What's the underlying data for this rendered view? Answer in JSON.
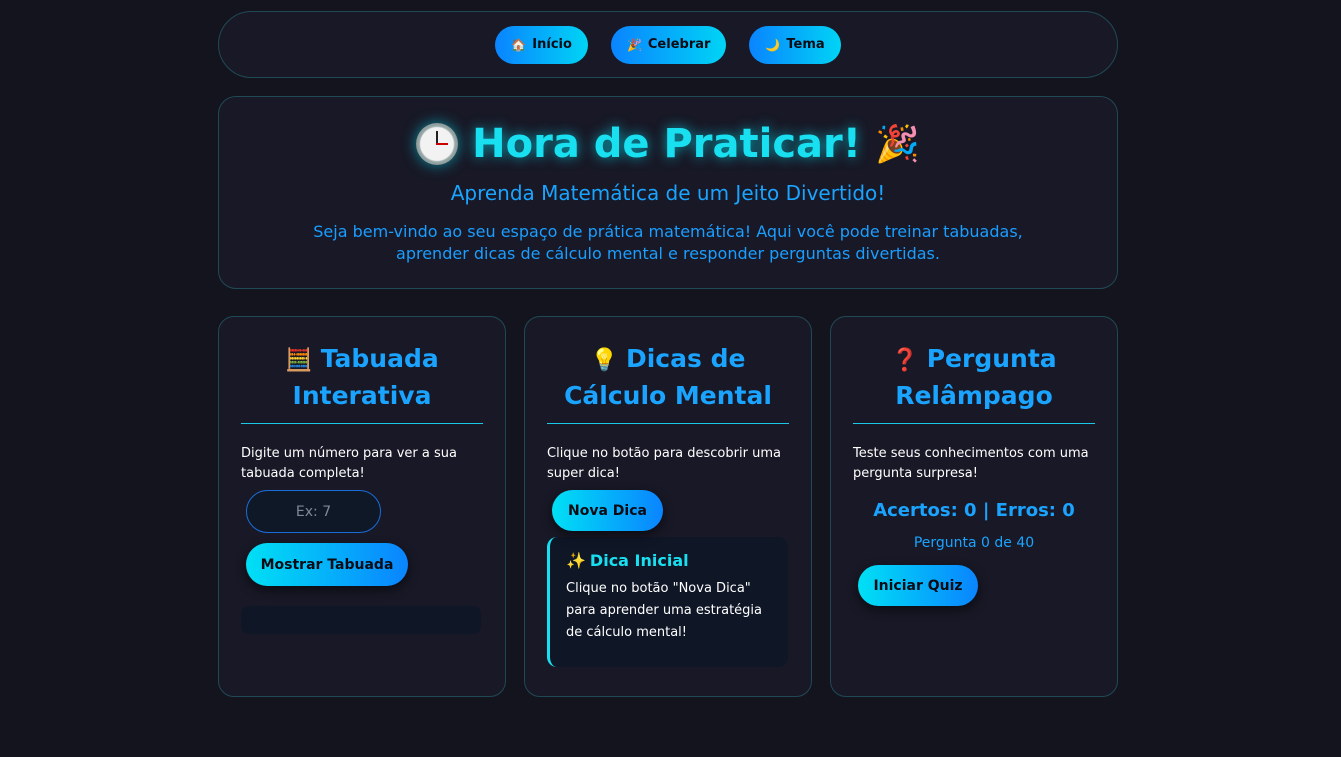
{
  "nav": {
    "items": [
      {
        "icon": "🏠",
        "label": "Início"
      },
      {
        "icon": "🎉",
        "label": "Celebrar"
      },
      {
        "icon": "🌙",
        "label": "Tema"
      }
    ]
  },
  "hero": {
    "title": "Hora de Praticar!",
    "party_icon": "🎉",
    "subtitle": "Aprenda Matemática de um Jeito Divertido!",
    "desc_line1": "Seja bem-vindo ao seu espaço de prática matemática! Aqui você pode treinar tabuadas,",
    "desc_line2": "aprender dicas de cálculo mental e responder perguntas divertidas."
  },
  "cards": {
    "tabuada": {
      "icon": "🧮",
      "title": "Tabuada Interativa",
      "text": "Digite um número para ver a sua tabuada completa!",
      "input_placeholder": "Ex: 7",
      "button": "Mostrar Tabuada"
    },
    "dicas": {
      "icon": "💡",
      "title": "Dicas de Cálculo Mental",
      "text": "Clique no botão para descobrir uma super dica!",
      "button": "Nova Dica",
      "tip_icon": "✨",
      "tip_title": "Dica Inicial",
      "tip_text": "Clique no botão \"Nova Dica\" para aprender uma estratégia de cálculo mental!"
    },
    "quiz": {
      "icon": "❓",
      "title": "Pergunta Relâmpago",
      "text": "Teste seus conhecimentos com uma pergunta surpresa!",
      "score": "Acertos: 0 | Erros: 0",
      "progress": "Pergunta 0 de 40",
      "button": "Iniciar Quiz"
    }
  }
}
